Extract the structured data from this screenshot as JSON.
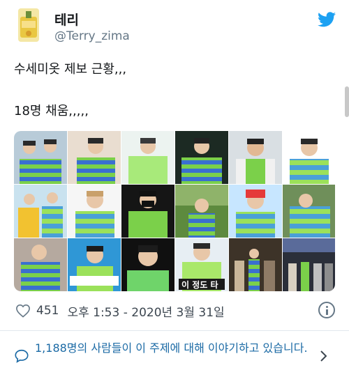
{
  "header": {
    "display_name": "테리",
    "handle": "@Terry_zima",
    "logo_icon": "twitter-bird-icon"
  },
  "tweet": {
    "line1": "수세미옷 제보 근황,,,",
    "line2": "18명 채움,,,,,",
    "media": {
      "grid_columns": 6,
      "grid_rows": 3,
      "photo_captions": [
        "이 정도 타"
      ]
    }
  },
  "meta": {
    "likes": "451",
    "timestamp": "오후 1:53 - 2020년 3월 31일",
    "heart_icon": "heart-outline-icon",
    "info_icon": "info-icon"
  },
  "conversation": {
    "text": "1,188명의 사람들이 이 주제에 대해 이야기하고 있습니다.",
    "bubble_icon": "speech-bubble-icon",
    "chevron_icon": "chevron-right-icon"
  },
  "colors": {
    "twitter_blue": "#1DA1F2",
    "link_blue": "#1B6AA5",
    "sweater_green": "#7BD04A",
    "sweater_blue": "#3A6FD0"
  }
}
